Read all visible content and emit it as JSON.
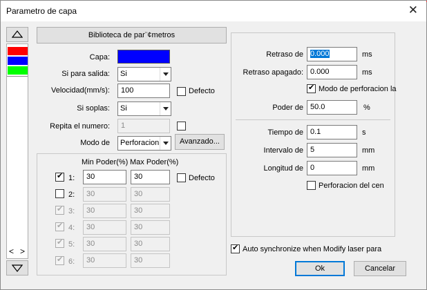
{
  "window": {
    "title": "Parametro de capa",
    "close": "✕"
  },
  "library_button": "Biblioteca de par¨¢metros",
  "layer_colors": [
    "#ff0000",
    "#0000ff",
    "#00ff00"
  ],
  "nav": {
    "scroll_left": "<",
    "scroll_right": ">"
  },
  "left": {
    "capa_label": "Capa:",
    "capa_color": "#0000ff",
    "salida_label": "Si para salida:",
    "salida_value": "Si",
    "velocidad_label": "Velocidad(mm/s):",
    "velocidad_value": "100",
    "defecto_label": "Defecto",
    "soplas_label": "Si soplas:",
    "soplas_value": "Si",
    "repita_label": "Repita el numero:",
    "repita_value": "1",
    "modo_label": "Modo de",
    "modo_value": "Perforacion",
    "avanzado_button": "Avanzado...",
    "min_header": "Min Poder(%)",
    "max_header": "Max Poder(%)",
    "defecto2_label": "Defecto",
    "rows": [
      {
        "label": "1:",
        "min": "30",
        "max": "30"
      },
      {
        "label": "2:",
        "min": "30",
        "max": "30"
      },
      {
        "label": "3:",
        "min": "30",
        "max": "30"
      },
      {
        "label": "4:",
        "min": "30",
        "max": "30"
      },
      {
        "label": "5:",
        "min": "30",
        "max": "30"
      },
      {
        "label": "6:",
        "min": "30",
        "max": "30"
      }
    ]
  },
  "right": {
    "retraso_label": "Retraso de",
    "retraso_value": "0.000",
    "retraso_unit": "ms",
    "apagado_label": "Retraso apagado:",
    "apagado_value": "0.000",
    "apagado_unit": "ms",
    "modo_perf_label": "Modo de perforacion la",
    "poder_label": "Poder de",
    "poder_value": "50.0",
    "poder_unit": "%",
    "tiempo_label": "Tiempo de",
    "tiempo_value": "0.1",
    "tiempo_unit": "s",
    "intervalo_label": "Intervalo de",
    "intervalo_value": "5",
    "intervalo_unit": "mm",
    "longitud_label": "Longitud de",
    "longitud_value": "0",
    "longitud_unit": "mm",
    "perf_centro_label": "Perforacion del cen"
  },
  "auto_sync_label": "Auto synchronize when Modify laser para",
  "ok_button": "Ok",
  "cancel_button": "Cancelar"
}
